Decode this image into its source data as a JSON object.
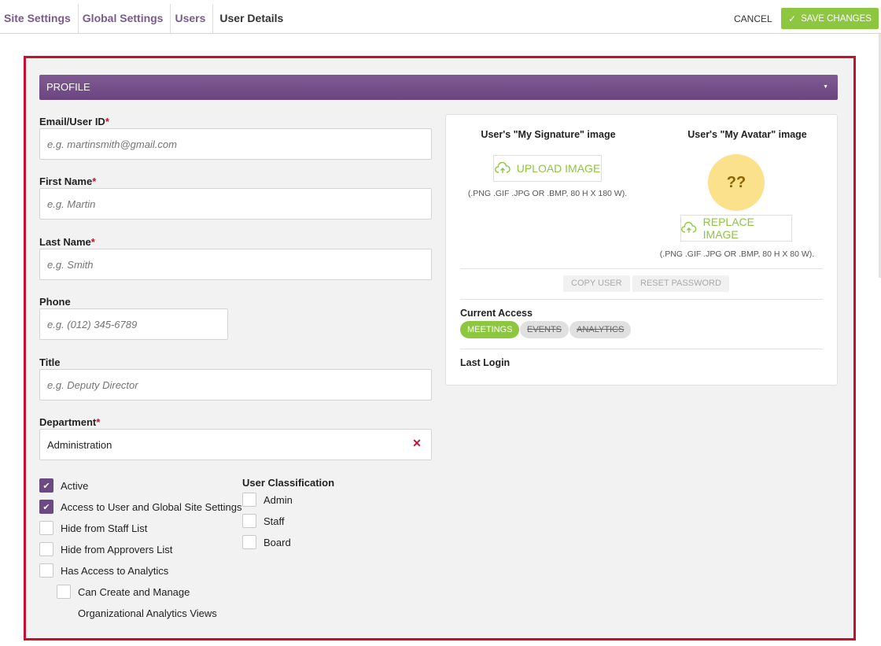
{
  "topbar": {
    "breadcrumbs": [
      "Site Settings",
      "Global Settings",
      "Users",
      "User Details"
    ],
    "cancel_label": "CANCEL",
    "save_label": "SAVE CHANGES"
  },
  "profile": {
    "header": "PROFILE",
    "fields": {
      "email": {
        "label": "Email/User ID",
        "required": "*",
        "placeholder": "e.g. martinsmith@gmail.com",
        "value": ""
      },
      "first_name": {
        "label": "First Name",
        "required": "*",
        "placeholder": "e.g. Martin",
        "value": ""
      },
      "last_name": {
        "label": "Last Name",
        "required": "*",
        "placeholder": "e.g. Smith",
        "value": ""
      },
      "phone": {
        "label": "Phone",
        "placeholder": "e.g. (012) 345-6789",
        "value": ""
      },
      "title": {
        "label": "Title",
        "placeholder": "e.g. Deputy Director",
        "value": ""
      },
      "department": {
        "label": "Department",
        "required": "*",
        "value": "Administration"
      }
    },
    "checkboxes": [
      {
        "label": "Active",
        "checked": true
      },
      {
        "label": "Access to User and Global Site Settings",
        "checked": true
      },
      {
        "label": "Hide from Staff List",
        "checked": false
      },
      {
        "label": "Hide from Approvers List",
        "checked": false
      },
      {
        "label": "Has Access to Analytics",
        "checked": false
      },
      {
        "label": "Can Create and Manage",
        "checked": false
      }
    ],
    "checkbox_continuation": "Organizational Analytics Views",
    "classification": {
      "title": "User Classification",
      "options": [
        {
          "label": "Admin",
          "checked": false
        },
        {
          "label": "Staff",
          "checked": false
        },
        {
          "label": "Board",
          "checked": false
        }
      ]
    }
  },
  "card": {
    "signature_title": "User's \"My Signature\" image",
    "upload_label": "UPLOAD IMAGE",
    "signature_hint": "(.PNG .GIF .JPG OR .BMP, 80 H X 180 W).",
    "avatar_title": "User's \"My Avatar\" image",
    "avatar_initials": "??",
    "replace_label": "REPLACE IMAGE",
    "avatar_hint": "(.PNG .GIF .JPG OR .BMP, 80 H X 80 W).",
    "copy_user_label": "COPY USER",
    "reset_password_label": "RESET PASSWORD",
    "current_access_label": "Current Access",
    "access": [
      {
        "label": "MEETINGS",
        "active": true
      },
      {
        "label": "EVENTS",
        "active": false
      },
      {
        "label": "ANALYTICS",
        "active": false
      }
    ],
    "last_login_label": "Last Login"
  },
  "colors": {
    "brand_purple": "#6a4580",
    "accent_green": "#8dc63f",
    "highlight_red": "#c8102e",
    "avatar_yellow": "#fbe18b"
  }
}
